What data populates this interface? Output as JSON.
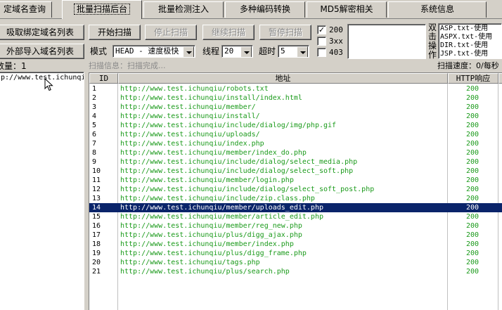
{
  "tabs": [
    "定域名查询",
    "批量扫描后台",
    "批量检测注入",
    "多种编码转换",
    "MD5解密相关",
    "系统信息"
  ],
  "active_tab_index": 1,
  "left_buttons": {
    "import_bound": "吸取绑定域名列表",
    "import_external": "外部导入域名列表"
  },
  "left": {
    "domain_count_label": "数量：1",
    "domain_list": [
      "p://www.test.ichunqi"
    ]
  },
  "controls": {
    "start": "开始扫描",
    "stop": "停止扫描",
    "resume": "继续扫描",
    "pause": "暂停扫描",
    "mode_label": "模式",
    "mode_value": "HEAD - 速度极快",
    "threads_label": "线程",
    "threads_value": "20",
    "timeout_label": "超时",
    "timeout_value": "5"
  },
  "status_filters": [
    {
      "label": "200",
      "checked": true
    },
    {
      "label": "3xx",
      "checked": false
    },
    {
      "label": "403",
      "checked": false
    }
  ],
  "dict": {
    "hint": "双击操作",
    "items": [
      "ASP.txt-使用",
      "ASPX.txt-使用",
      "DIR.txt-使用",
      "JSP.txt-使用"
    ]
  },
  "scan_info": "扫描信息：扫描完成...",
  "scan_speed": "扫描速度：0/每秒",
  "table": {
    "headers": [
      "ID",
      "地址",
      "HTTP响应"
    ],
    "selected_index": 13,
    "rows": [
      {
        "id": "1",
        "url": "http://www.test.ichunqiu/robots.txt",
        "code": "200"
      },
      {
        "id": "2",
        "url": "http://www.test.ichunqiu/install/index.html",
        "code": "200"
      },
      {
        "id": "3",
        "url": "http://www.test.ichunqiu/member/",
        "code": "200"
      },
      {
        "id": "4",
        "url": "http://www.test.ichunqiu/install/",
        "code": "200"
      },
      {
        "id": "5",
        "url": "http://www.test.ichunqiu/include/dialog/img/php.gif",
        "code": "200"
      },
      {
        "id": "6",
        "url": "http://www.test.ichunqiu/uploads/",
        "code": "200"
      },
      {
        "id": "7",
        "url": "http://www.test.ichunqiu/index.php",
        "code": "200"
      },
      {
        "id": "8",
        "url": "http://www.test.ichunqiu/member/index_do.php",
        "code": "200"
      },
      {
        "id": "9",
        "url": "http://www.test.ichunqiu/include/dialog/select_media.php",
        "code": "200"
      },
      {
        "id": "10",
        "url": "http://www.test.ichunqiu/include/dialog/select_soft.php",
        "code": "200"
      },
      {
        "id": "11",
        "url": "http://www.test.ichunqiu/member/login.php",
        "code": "200"
      },
      {
        "id": "12",
        "url": "http://www.test.ichunqiu/include/dialog/select_soft_post.php",
        "code": "200"
      },
      {
        "id": "13",
        "url": "http://www.test.ichunqiu/include/zip.class.php",
        "code": "200"
      },
      {
        "id": "14",
        "url": "http://www.test.ichunqiu/member/uploads_edit.php",
        "code": "200"
      },
      {
        "id": "15",
        "url": "http://www.test.ichunqiu/member/article_edit.php",
        "code": "200"
      },
      {
        "id": "16",
        "url": "http://www.test.ichunqiu/member/reg_new.php",
        "code": "200"
      },
      {
        "id": "17",
        "url": "http://www.test.ichunqiu/plus/digg_ajax.php",
        "code": "200"
      },
      {
        "id": "18",
        "url": "http://www.test.ichunqiu/member/index.php",
        "code": "200"
      },
      {
        "id": "19",
        "url": "http://www.test.ichunqiu/plus/digg_frame.php",
        "code": "200"
      },
      {
        "id": "20",
        "url": "http://www.test.ichunqiu/tags.php",
        "code": "200"
      },
      {
        "id": "21",
        "url": "http://www.test.ichunqiu/plus/search.php",
        "code": "200"
      }
    ]
  }
}
